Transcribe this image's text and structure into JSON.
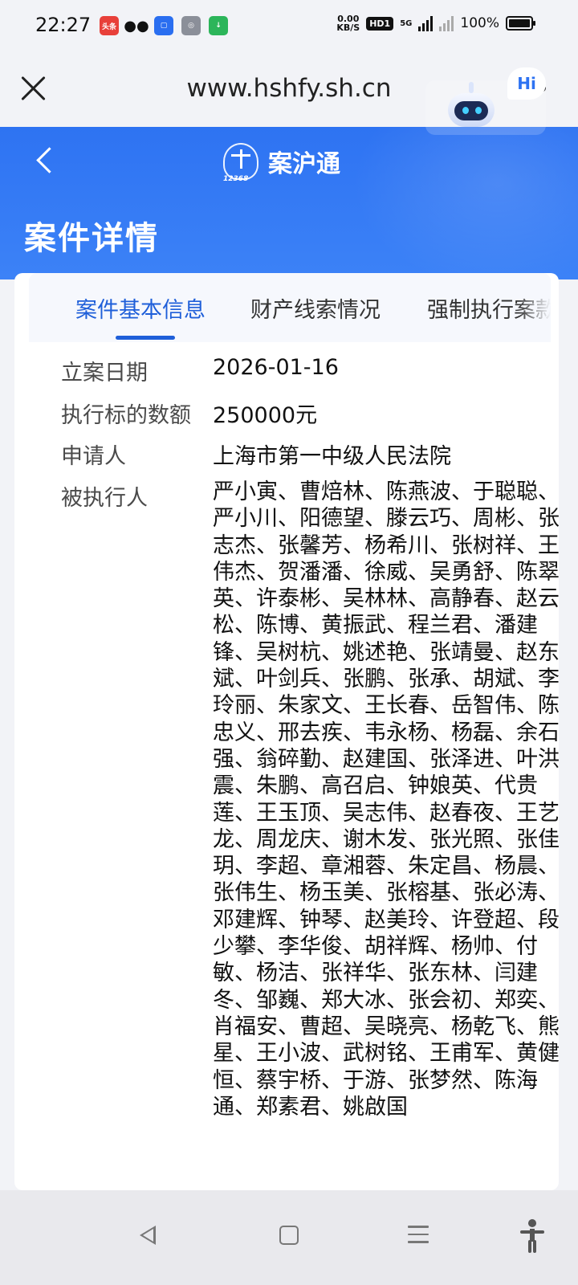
{
  "status_bar": {
    "time": "22:27",
    "net_speed_value": "0.00",
    "net_speed_unit": "KB/S",
    "hd_badge": "HD1",
    "network_type": "5G",
    "battery": "100%",
    "battery_level": 1.0,
    "notification_icons": [
      "toutiao-icon",
      "wechat-icon",
      "app-blue-icon",
      "app-gray-icon",
      "app-green-icon"
    ],
    "toutiao_label": "头条"
  },
  "browser": {
    "url": "www.hshfy.sh.cn",
    "close_icon": "close-icon",
    "more_icon": "more-dots-icon"
  },
  "header": {
    "brand_name": "案沪通",
    "brand_logo_number": "12368",
    "page_title": "案件详情",
    "hi_bubble": "Hi",
    "accent_color": "#2e73f2"
  },
  "tabs": [
    {
      "label": "案件基本信息",
      "active": true
    },
    {
      "label": "财产线索情况",
      "active": false
    },
    {
      "label": "强制执行案款",
      "active": false
    }
  ],
  "details": {
    "filing_date_label": "立案日期",
    "filing_date": "2026-01-16",
    "amount_label": "执行标的数额",
    "amount": "250000元",
    "applicant_label": "申请人",
    "applicant": "上海市第一中级人民法院",
    "debtors_label": "被执行人",
    "debtors": "严小寅、曹焙林、陈燕波、于聪聪、严小川、阳德望、滕云巧、周彬、张志杰、张馨芳、杨希川、张树祥、王伟杰、贺潘潘、徐威、吴勇舒、陈翠英、许泰彬、吴林林、高静春、赵云松、陈博、黄振武、程兰君、潘建锋、吴树杭、姚述艳、张靖曼、赵东斌、叶剑兵、张鹏、张承、胡斌、李玲丽、朱家文、王长春、岳智伟、陈忠义、邢去疾、韦永杨、杨磊、余石强、翁碎勤、赵建国、张泽进、叶洪震、朱鹏、高召启、钟娘英、代贵莲、王玉顶、吴志伟、赵春夜、王艺龙、周龙庆、谢木发、张光照、张佳玥、李超、章湘蓉、朱定昌、杨晨、张伟生、杨玉美、张榕基、张必涛、邓建辉、钟琴、赵美玲、许登超、段少攀、李华俊、胡祥辉、杨帅、付敏、杨洁、张祥华、张东林、闫建冬、邹巍、郑大冰、张会初、郑奕、肖福安、曹超、吴晓亮、杨乾飞、熊星、王小波、武树铭、王甫军、黄健恒、蔡宇桥、于游、张梦然、陈海通、郑素君、姚啟国"
  },
  "nav_bar": {
    "icons": [
      "back-triangle-icon",
      "home-square-icon",
      "menu-lines-icon",
      "accessibility-icon"
    ]
  }
}
